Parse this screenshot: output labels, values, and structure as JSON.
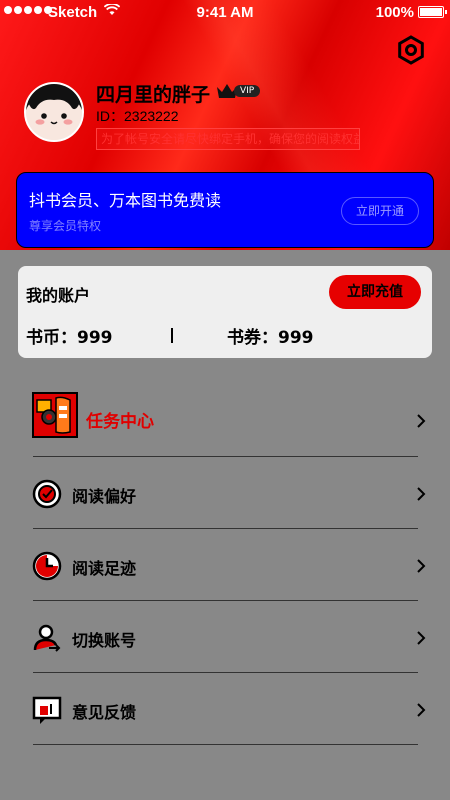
{
  "status_bar": {
    "carrier": "Sketch",
    "time": "9:41 AM",
    "battery": "100%"
  },
  "profile": {
    "name": "四月里的胖子",
    "vip_badge": "VIP",
    "id": "ID：2323222",
    "note": "为了帐号安全请尽快绑定手机，确保您的阅读权益"
  },
  "vip_card": {
    "title": "抖书会员、万本图书免费读",
    "subtitle": "尊享会员特权",
    "button": "立即开通"
  },
  "account": {
    "title": "我的账户",
    "recharge_label": "立即充值",
    "coins": "书币：999",
    "coupons": "书券：999"
  },
  "menu": [
    {
      "label": "任务中心",
      "icon": "task-center-icon"
    },
    {
      "label": "阅读偏好",
      "icon": "reading-preference-icon"
    },
    {
      "label": "阅读足迹",
      "icon": "reading-history-icon"
    },
    {
      "label": "切换账号",
      "icon": "switch-account-icon"
    },
    {
      "label": "意见反馈",
      "icon": "feedback-icon"
    }
  ],
  "colors": {
    "header_red": "#e00000",
    "vip_card_blue": "#0000ff",
    "page_gray": "#888888",
    "recharge_red": "#e60000"
  }
}
